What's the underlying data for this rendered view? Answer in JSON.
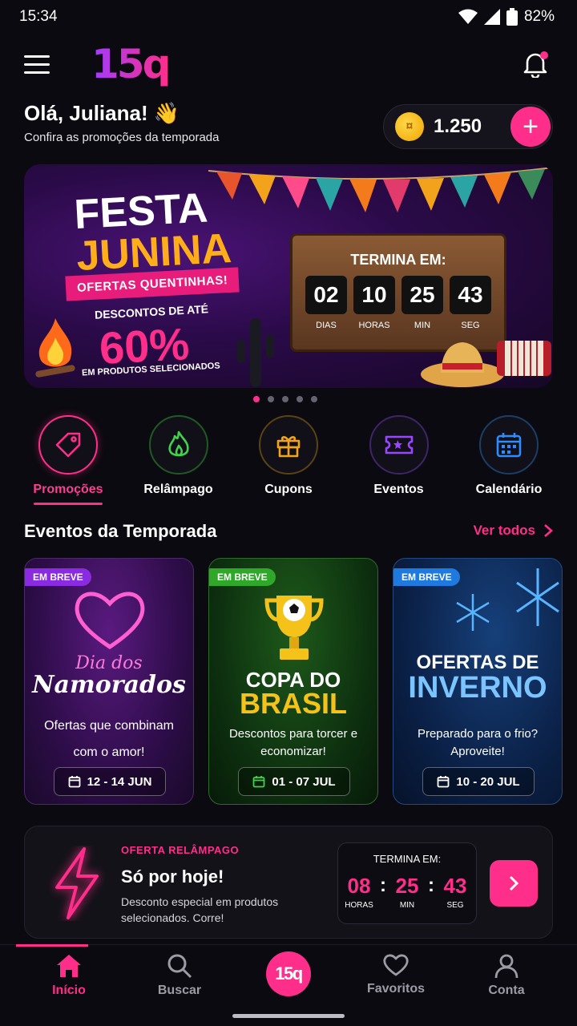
{
  "status": {
    "time": "15:34",
    "battery": "82%"
  },
  "header": {
    "logo": "15q"
  },
  "greeting": {
    "title": "Olá, Juliana! 👋",
    "subtitle": "Confira as promoções da temporada"
  },
  "coins": {
    "value": "1.250",
    "add": "+"
  },
  "banner": {
    "line1": "FESTA",
    "line2": "JUNINA",
    "ribbon": "OFERTAS QUENTINHAS!",
    "discount_label": "DESCONTOS DE ATÉ",
    "discount_value": "60%",
    "products_label": "EM PRODUTOS SELECIONADOS",
    "timer_title": "TERMINA EM:",
    "timer": [
      {
        "value": "02",
        "label": "DIAS"
      },
      {
        "value": "10",
        "label": "HORAS"
      },
      {
        "value": "25",
        "label": "MIN"
      },
      {
        "value": "43",
        "label": "SEG"
      }
    ]
  },
  "carousel": {
    "count": 5,
    "active": 0
  },
  "categories": [
    {
      "label": "Promoções",
      "icon": "tag-icon",
      "color": "#ff2e8a"
    },
    {
      "label": "Relâmpago",
      "icon": "flame-icon",
      "color": "#3fd24a"
    },
    {
      "label": "Cupons",
      "icon": "gift-icon",
      "color": "#f2a51b"
    },
    {
      "label": "Eventos",
      "icon": "ticket-icon",
      "color": "#9a45ff"
    },
    {
      "label": "Calendário",
      "icon": "calendar-icon",
      "color": "#2d8cff"
    }
  ],
  "section": {
    "title": "Eventos da Temporada",
    "see_all": "Ver todos"
  },
  "events": [
    {
      "badge": "EM BREVE",
      "badge_color": "#8a2be2",
      "title1": "Dia dos",
      "title2": "Namorados",
      "subtitle": "Ofertas que combinam com o amor!",
      "date": "12 - 14 JUN"
    },
    {
      "badge": "EM BREVE",
      "badge_color": "#2fa82a",
      "title1": "COPA DO",
      "title2": "BRASIL",
      "subtitle": "Descontos para torcer e economizar!",
      "date": "01 - 07 JUL"
    },
    {
      "badge": "EM BREVE",
      "badge_color": "#1f7ae0",
      "title1": "OFERTAS DE",
      "title2": "INVERNO",
      "subtitle": "Preparado para o frio? Aproveite!",
      "date": "10 - 20 JUL"
    }
  ],
  "flash": {
    "label": "OFERTA RELÂMPAGO",
    "title": "Só por hoje!",
    "description": "Desconto especial em produtos selecionados. Corre!",
    "timer_title": "TERMINA EM:",
    "hours": "08",
    "hours_label": "HORAS",
    "minutes": "25",
    "minutes_label": "MIN",
    "seconds": "43",
    "seconds_label": "SEG"
  },
  "nav": {
    "home": "Início",
    "search": "Buscar",
    "center": "15q",
    "favorites": "Favoritos",
    "account": "Conta"
  },
  "colors": {
    "accent": "#ff2e8a",
    "background": "#0b0a10"
  }
}
